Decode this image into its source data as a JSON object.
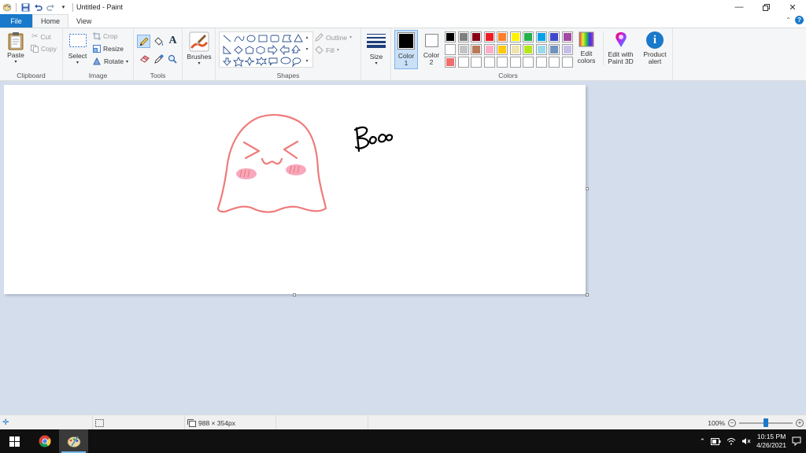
{
  "window": {
    "title": "Untitled - Paint"
  },
  "tabs": {
    "file": "File",
    "home": "Home",
    "view": "View"
  },
  "ribbon": {
    "clipboard": {
      "label": "Clipboard",
      "paste": "Paste",
      "cut": "Cut",
      "copy": "Copy"
    },
    "image": {
      "label": "Image",
      "select": "Select",
      "crop": "Crop",
      "resize": "Resize",
      "rotate": "Rotate"
    },
    "tools": {
      "label": "Tools"
    },
    "brushes": {
      "label": "Brushes"
    },
    "shapes": {
      "label": "Shapes",
      "outline": "Outline",
      "fill": "Fill"
    },
    "size": {
      "label": "Size"
    },
    "colors": {
      "label": "Colors",
      "color1": "Color",
      "color1_num": "1",
      "color2": "Color",
      "color2_num": "2",
      "edit_colors_1": "Edit",
      "edit_colors_2": "colors",
      "color1_value": "#000000",
      "color2_value": "#ffffff",
      "palette": [
        "#000000",
        "#7f7f7f",
        "#880015",
        "#ed1c24",
        "#ff7f27",
        "#fff200",
        "#22b14c",
        "#00a2e8",
        "#3f48cc",
        "#a349a4",
        "#ffffff",
        "#c3c3c3",
        "#b97a57",
        "#ffaec9",
        "#ffc90e",
        "#efe4b0",
        "#b5e61d",
        "#99d9ea",
        "#7092be",
        "#c8bfe7",
        "#f26d6d",
        "#ffffff",
        "#ffffff",
        "#ffffff",
        "#ffffff",
        "#ffffff",
        "#ffffff",
        "#ffffff",
        "#ffffff",
        "#ffffff"
      ]
    },
    "paint3d": {
      "line1": "Edit with",
      "line2": "Paint 3D"
    },
    "product_alert": {
      "line1": "Product",
      "line2": "alert"
    }
  },
  "status": {
    "canvas_size": "988 × 354px",
    "zoom": "100%",
    "zoom_fraction": 0.5
  },
  "taskbar": {
    "time": "10:15 PM",
    "date": "4/26/2021"
  },
  "drawing": {
    "ghost_color": "#ef7b7b",
    "blush_color": "#f7a8bd",
    "ink_color": "#000000"
  }
}
